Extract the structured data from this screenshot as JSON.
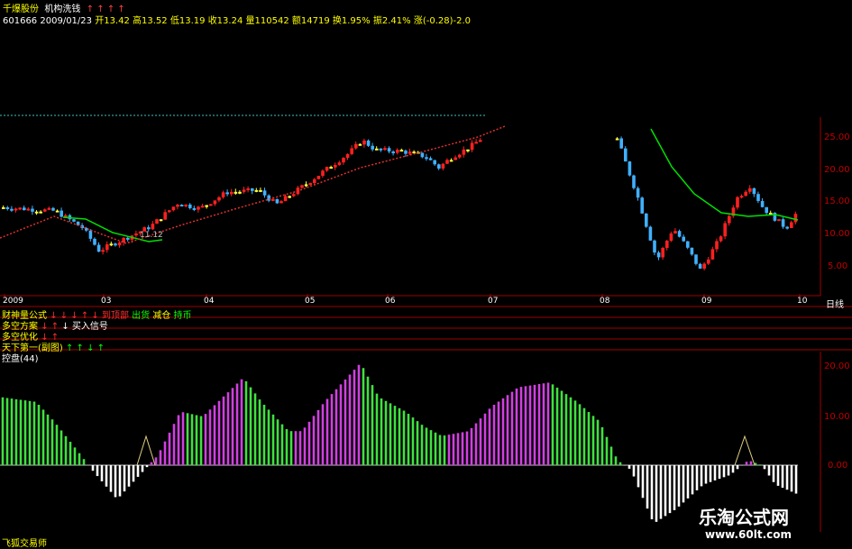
{
  "header": {
    "name": "千爆股份",
    "indicator": "机构洗钱",
    "arrows": "↑ ↑ ↑ ↑",
    "code": "601666",
    "date": "2009/01/23",
    "open": "开13.42",
    "high": "高13.52",
    "low": "低13.19",
    "close": "收13.24",
    "volume": "量110542",
    "amount": "额14719",
    "turnover": "换1.95%",
    "amplitude": "振2.41%",
    "change": "涨(-0.28)-2.0"
  },
  "main_chart": {
    "y_ticks": [
      "25.00",
      "20.00",
      "15.00",
      "10.00",
      "5.00"
    ],
    "x_ticks": [
      "2009",
      "03",
      "04",
      "05",
      "06",
      "07",
      "08",
      "09",
      "10"
    ],
    "period_label": "日线",
    "low_annotation": "11.12"
  },
  "signal_rows": [
    {
      "label": "财神量公式",
      "extra": [
        {
          "t": "到顶部",
          "c": "red"
        },
        {
          "t": "出货",
          "c": "green"
        },
        {
          "t": "减仓",
          "c": "yellow"
        },
        {
          "t": "持币",
          "c": "green"
        }
      ],
      "arrows": "↓ ↓ ↓ ↑ ↓"
    },
    {
      "label": "多空方案",
      "extra": [
        {
          "t": "↓ 买入信号",
          "c": "white"
        }
      ],
      "arrows": "↓ ↑"
    },
    {
      "label": "多空优化",
      "extra": [],
      "arrows": "↓ ↑"
    },
    {
      "label": "天下第一(副图)",
      "extra": [],
      "arrows": "↑ ↑ ↓ ↑"
    }
  ],
  "sub_chart": {
    "title": "控盘(44)",
    "y_ticks": [
      "20.00",
      "10.00",
      "0.00"
    ]
  },
  "footer": {
    "left_label": "飞狐交易师",
    "watermark_title": "乐淘公式网",
    "watermark_url": "www.60lt.com"
  },
  "colors": {
    "up": "#ff2020",
    "down": "#40b0ff",
    "doji": "#ffff40",
    "ma_green": "#00e000",
    "dotted_red": "#e03030",
    "bar_magenta": "#d040e0",
    "bar_green": "#40e040",
    "bar_white": "#ffffff"
  }
}
